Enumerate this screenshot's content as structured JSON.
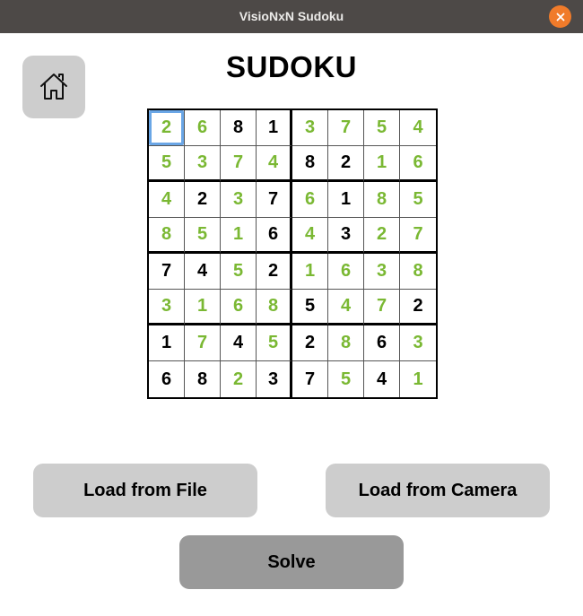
{
  "window": {
    "title": "VisioNxN Sudoku"
  },
  "header": {
    "title": "SUDOKU"
  },
  "icons": {
    "home": "home-icon",
    "close": "close-icon"
  },
  "colors": {
    "given": "#000000",
    "solved": "#7ab833",
    "selection": "#6aa6e6",
    "close_button": "#f07b2a"
  },
  "board": {
    "selected": [
      0,
      0
    ],
    "rows": [
      [
        {
          "v": "2",
          "s": true
        },
        {
          "v": "6",
          "s": true
        },
        {
          "v": "8",
          "s": false
        },
        {
          "v": "1",
          "s": false
        },
        {
          "v": "3",
          "s": true
        },
        {
          "v": "7",
          "s": true
        },
        {
          "v": "5",
          "s": true
        },
        {
          "v": "4",
          "s": true
        }
      ],
      [
        {
          "v": "5",
          "s": true
        },
        {
          "v": "3",
          "s": true
        },
        {
          "v": "7",
          "s": true
        },
        {
          "v": "4",
          "s": true
        },
        {
          "v": "8",
          "s": false
        },
        {
          "v": "2",
          "s": false
        },
        {
          "v": "1",
          "s": true
        },
        {
          "v": "6",
          "s": true
        }
      ],
      [
        {
          "v": "4",
          "s": true
        },
        {
          "v": "2",
          "s": false
        },
        {
          "v": "3",
          "s": true
        },
        {
          "v": "7",
          "s": false
        },
        {
          "v": "6",
          "s": true
        },
        {
          "v": "1",
          "s": false
        },
        {
          "v": "8",
          "s": true
        },
        {
          "v": "5",
          "s": true
        }
      ],
      [
        {
          "v": "8",
          "s": true
        },
        {
          "v": "5",
          "s": true
        },
        {
          "v": "1",
          "s": true
        },
        {
          "v": "6",
          "s": false
        },
        {
          "v": "4",
          "s": true
        },
        {
          "v": "3",
          "s": false
        },
        {
          "v": "2",
          "s": true
        },
        {
          "v": "7",
          "s": true
        }
      ],
      [
        {
          "v": "7",
          "s": false
        },
        {
          "v": "4",
          "s": false
        },
        {
          "v": "5",
          "s": true
        },
        {
          "v": "2",
          "s": false
        },
        {
          "v": "1",
          "s": true
        },
        {
          "v": "6",
          "s": true
        },
        {
          "v": "3",
          "s": true
        },
        {
          "v": "8",
          "s": true
        }
      ],
      [
        {
          "v": "3",
          "s": true
        },
        {
          "v": "1",
          "s": true
        },
        {
          "v": "6",
          "s": true
        },
        {
          "v": "8",
          "s": true
        },
        {
          "v": "5",
          "s": false
        },
        {
          "v": "4",
          "s": true
        },
        {
          "v": "7",
          "s": true
        },
        {
          "v": "2",
          "s": false
        }
      ],
      [
        {
          "v": "1",
          "s": false
        },
        {
          "v": "7",
          "s": true
        },
        {
          "v": "4",
          "s": false
        },
        {
          "v": "5",
          "s": true
        },
        {
          "v": "2",
          "s": false
        },
        {
          "v": "8",
          "s": true
        },
        {
          "v": "6",
          "s": false
        },
        {
          "v": "3",
          "s": true
        }
      ],
      [
        {
          "v": "6",
          "s": false
        },
        {
          "v": "8",
          "s": false
        },
        {
          "v": "2",
          "s": true
        },
        {
          "v": "3",
          "s": false
        },
        {
          "v": "7",
          "s": false
        },
        {
          "v": "5",
          "s": true
        },
        {
          "v": "4",
          "s": false
        },
        {
          "v": "1",
          "s": true
        }
      ]
    ]
  },
  "buttons": {
    "load_file": "Load from File",
    "load_camera": "Load from Camera",
    "solve": "Solve"
  }
}
